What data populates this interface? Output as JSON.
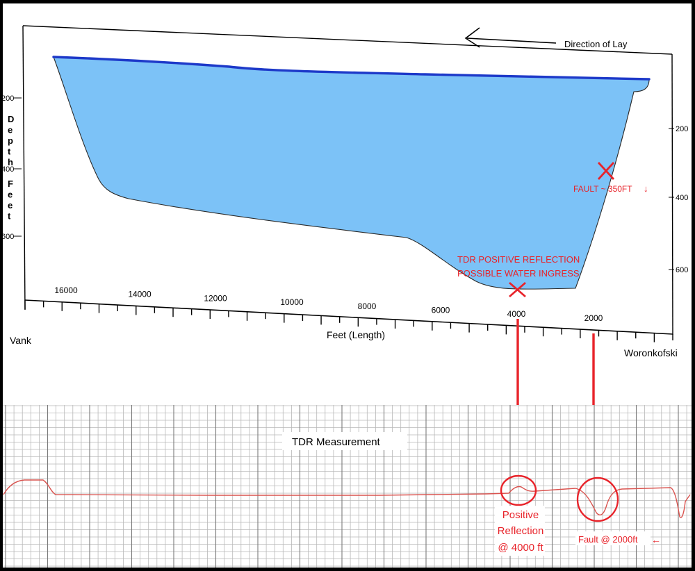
{
  "colors": {
    "water_fill": "#7cc2f7",
    "surface_line": "#1d39c9",
    "annotation_red": "#e8232a",
    "grid": "#9a9a9a",
    "trace": "#d9534f"
  },
  "top_panel": {
    "direction_label": "Direction of Lay",
    "depth_label_letters": [
      "D",
      "e",
      "p",
      "t",
      "h",
      "",
      "F",
      "e",
      "e",
      "t"
    ],
    "x_axis_label": "Feet (Length)",
    "left_end_label": "Vank",
    "right_end_label": "Woronkofski",
    "x_tick_labels": [
      "16000",
      "14000",
      "12000",
      "10000",
      "8000",
      "6000",
      "4000",
      "2000"
    ],
    "left_depth_ticks": [
      "200",
      "400",
      "600"
    ],
    "right_depth_ticks": [
      "200",
      "400",
      "600"
    ],
    "annotations": {
      "fault": "FAULT ~ 350FT",
      "fault_arrow": "↓",
      "tdr_line1": "TDR POSITIVE REFLECTION",
      "tdr_line2": "POSSIBLE WATER INGRESS"
    }
  },
  "bottom_panel": {
    "title": "TDR Measurement",
    "positive_line1": "Positive",
    "positive_line2": "Reflection",
    "positive_line3": "@ 4000 ft",
    "fault_label": "Fault @ 2000ft",
    "fault_arrow": "←"
  }
}
